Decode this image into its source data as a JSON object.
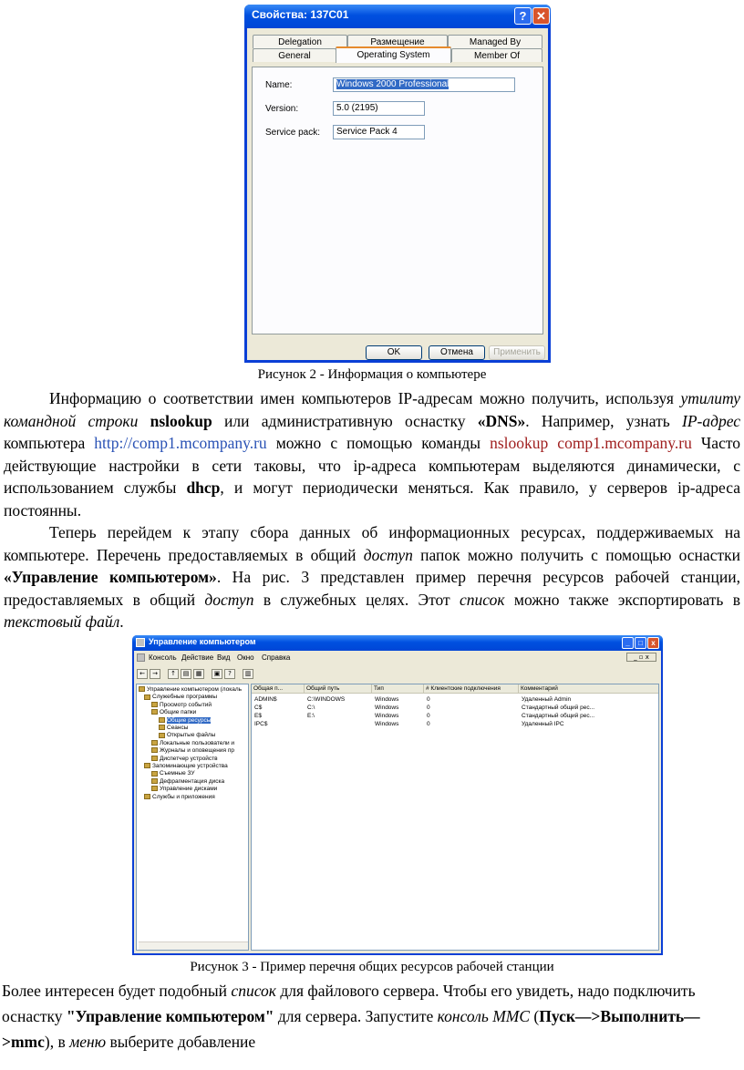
{
  "fig2": {
    "title": "Свойства: 137C01",
    "help": "?",
    "close": "✕",
    "tabs_top": [
      "Delegation",
      "Размещение",
      "Managed By"
    ],
    "tabs_bottom": [
      "General",
      "Operating System",
      "Member Of"
    ],
    "fields": [
      {
        "label": "Name:",
        "value": "Windows 2000 Professional"
      },
      {
        "label": "Version:",
        "value": "5.0 (2195)"
      },
      {
        "label": "Service pack:",
        "value": "Service Pack 4"
      }
    ],
    "buttons": {
      "ok": "OK",
      "cancel": "Отмена",
      "apply": "Применить"
    },
    "caption": "Рисунок 2 - Информация о компьютере"
  },
  "p1": {
    "t1": "Информацию о соответствии имен компьютеров IP-адресам можно получить, используя ",
    "i1": "утилиту командной строки",
    "t2": " ",
    "b1": "nslookup",
    "t3": " или административную оснастку ",
    "b2": "«DNS»",
    "t4": ". Например, узнать ",
    "i2": "IP-адрес",
    "t5": " компьютера ",
    "link": "http://comp1.mcompany.ru",
    "t6": " можно с помощью команды ",
    "cmd": "nslookup comp1.mcompany.ru",
    "t7": " Часто действующие настройки в сети таковы, что ip-адреса компьютерам выделяются динамически, с использованием службы ",
    "b3": "dhcp",
    "t8": ", и могут периодически меняться. Как правило, у серверов ip-адреса постоянны."
  },
  "p2": {
    "t1": "Теперь перейдем к этапу сбора данных об информационных ресурсах, поддерживаемых на компьютере. Перечень предоставляемых в общий ",
    "i1": "доступ",
    "t2": " папок можно получить с помощью оснастки ",
    "b1": "«Управление компьютером»",
    "t3": ". На рис. 3 представлен пример перечня ресурсов рабочей станции, предоставляемых в общий ",
    "i2": "доступ",
    "t4": " в служебных целях. Этот ",
    "i3": "список",
    "t5": " можно также экспортировать в ",
    "i4": "текстовый файл",
    "t6": "."
  },
  "fig3": {
    "title": "Управление компьютером",
    "menu": [
      "Консоль",
      "Действие",
      "Вид",
      "Окно",
      "Справка"
    ],
    "tree": [
      "Управление компьютером (локаль",
      "Служебные программы",
      "Просмотр событий",
      "Общие папки",
      "Общие ресурсы",
      "Сеансы",
      "Открытые файлы",
      "Локальные пользователи и",
      "Журналы и оповещения пр",
      "Диспетчер устройств",
      "Запоминающие устройства",
      "Съемные ЗУ",
      "Дефрагментация диска",
      "Управление дисками",
      "Службы и приложения"
    ],
    "columns": [
      "Общая п...",
      "Общий путь",
      "Тип",
      "# Клиентские подключения",
      "Комментарий"
    ],
    "rows": [
      [
        "ADMIN$",
        "C:\\WINDOWS",
        "Windows",
        "0",
        "Удаленный Admin"
      ],
      [
        "C$",
        "C:\\",
        "Windows",
        "0",
        "Стандартный общий рес..."
      ],
      [
        "E$",
        "E:\\",
        "Windows",
        "0",
        "Стандартный общий рес..."
      ],
      [
        "IPC$",
        "",
        "Windows",
        "0",
        "Удаленный IPC"
      ]
    ],
    "caption": "Рисунок 3 - Пример перечня общих ресурсов рабочей станции"
  },
  "p3": {
    "t1": "Более интересен будет подобный ",
    "i1": "список",
    "t2": " для файлового сервера. Чтобы его увидеть, надо подключить оснастку ",
    "b1": "\"Управление компьютером\"",
    "t3": " для сервера. Запустите ",
    "i2": "консоль MMC",
    "t4": " (",
    "b2": "Пуск—>Выполнить—>mmc",
    "t5": "), в ",
    "i3": "меню",
    "t6": " выберите добавление"
  }
}
